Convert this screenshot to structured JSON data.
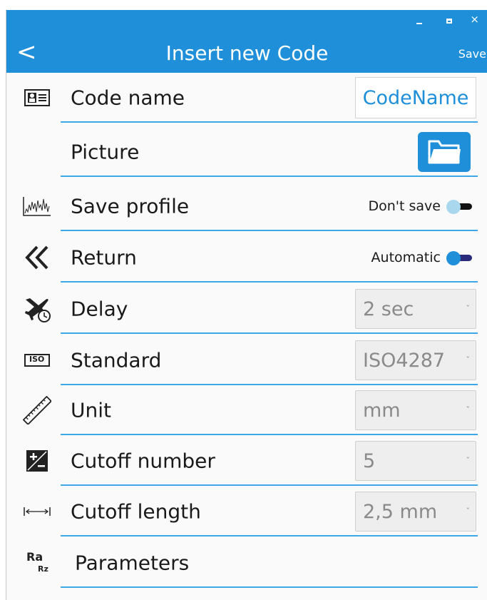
{
  "window": {
    "minimize": "–",
    "maximize": "□",
    "close": "×"
  },
  "header": {
    "back_label": "<",
    "title": "Insert new Code",
    "save_label": "Save"
  },
  "rows": [
    {
      "label": "Code name",
      "icon": "id-card-icon",
      "control": "text",
      "value": "CodeName"
    },
    {
      "label": "Picture",
      "icon": "none",
      "control": "folder-button"
    },
    {
      "label": "Save profile",
      "icon": "profile-graph-icon",
      "control": "toggle",
      "toggle_text": "Don't save",
      "on": false
    },
    {
      "label": "Return",
      "icon": "double-chevron-left-icon",
      "control": "toggle",
      "toggle_text": "Automatic",
      "on": true
    },
    {
      "label": "Delay",
      "icon": "plane-clock-icon",
      "control": "dropdown",
      "value": "2 sec"
    },
    {
      "label": "Standard",
      "icon": "iso-icon",
      "icon_text": "ISO",
      "control": "dropdown",
      "value": "ISO4287"
    },
    {
      "label": "Unit",
      "icon": "ruler-icon",
      "control": "dropdown",
      "value": "mm"
    },
    {
      "label": "Cutoff number",
      "icon": "plus-minus-icon",
      "control": "dropdown",
      "value": "5"
    },
    {
      "label": "Cutoff length",
      "icon": "arrow-width-icon",
      "control": "dropdown",
      "value": "2,5 mm"
    },
    {
      "label": "Parameters",
      "icon": "ra-rz-icon",
      "icon_text_top": "Ra",
      "icon_text_bottom": "Rz",
      "control": "none"
    }
  ],
  "colors": {
    "accent": "#1e8fd8",
    "line": "#3ea7e6",
    "toggle_off_knob": "#a9d8ee",
    "toggle_on_knob": "#1e8fd8",
    "toggle_track_dark": "#111111",
    "toggle_track_on": "#2a2a7a"
  }
}
